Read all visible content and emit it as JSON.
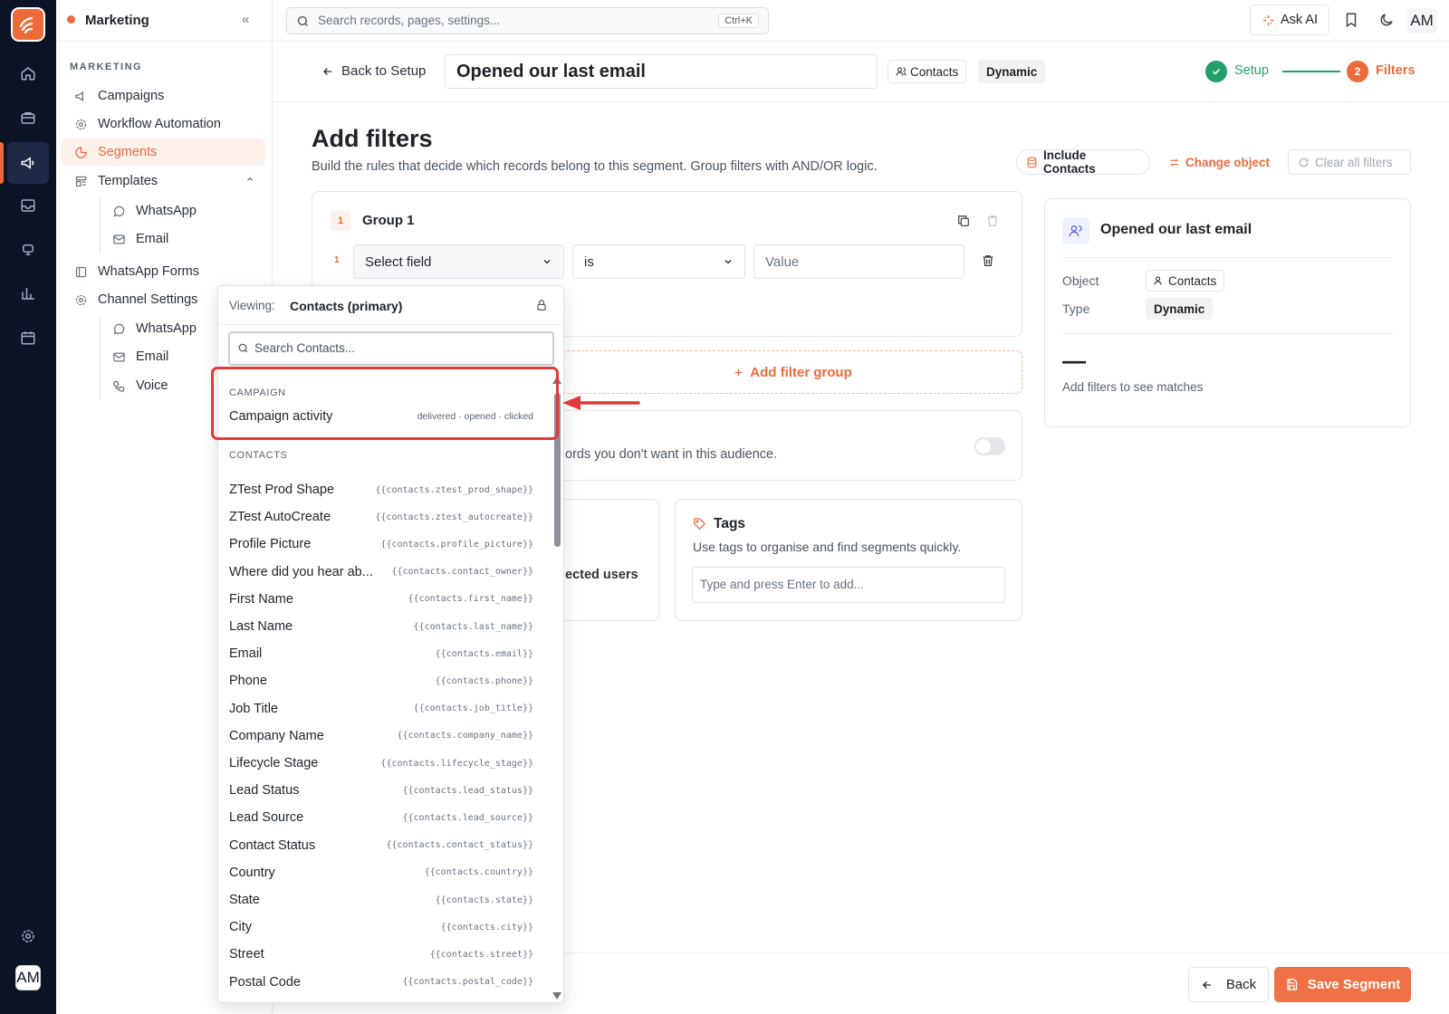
{
  "rail": {
    "avatar": "AM"
  },
  "sidebar": {
    "workspace": "Marketing",
    "collapse_icon": "«",
    "section": "MARKETING",
    "items": {
      "campaigns": "Campaigns",
      "workflow": "Workflow Automation",
      "segments": "Segments",
      "templates": "Templates",
      "tpl_whatsapp": "WhatsApp",
      "tpl_email": "Email",
      "whatsapp_forms": "WhatsApp Forms",
      "channel_settings": "Channel Settings",
      "ch_whatsapp": "WhatsApp",
      "ch_email": "Email",
      "ch_voice": "Voice"
    }
  },
  "topbar": {
    "search_placeholder": "Search records, pages, settings...",
    "shortcut": "Ctrl+K",
    "ask_ai": "Ask AI",
    "avatar": "AM"
  },
  "header": {
    "back": "Back to Setup",
    "segment_name": "Opened our last email",
    "object_chip": "Contacts",
    "type_chip": "Dynamic",
    "step1": "Setup",
    "step2_num": "2",
    "step2": "Filters"
  },
  "main": {
    "title": "Add filters",
    "subtitle": "Build the rules that decide which records belong to this segment. Group filters with AND/OR logic.",
    "include_contacts": "Include Contacts",
    "change_object": "Change object",
    "clear_all": "Clear all filters",
    "group_num": "1",
    "group_title": "Group 1",
    "row_num": "1",
    "field_placeholder": "Select field",
    "operator": "is",
    "value_placeholder": "Value",
    "add_group": "Add filter group",
    "exclude_text": "ords you don't want in this audience.",
    "selected_users_text": "ected users",
    "tags_title": "Tags",
    "tags_desc": "Use tags to organise and find segments quickly.",
    "tags_placeholder": "Type and press Enter to add..."
  },
  "summary": {
    "title": "Opened our last email",
    "object_label": "Object",
    "object_value": "Contacts",
    "type_label": "Type",
    "type_value": "Dynamic",
    "count": "—",
    "hint": "Add filters to see matches"
  },
  "footer": {
    "back": "Back",
    "save": "Save Segment"
  },
  "dropdown": {
    "viewing_label": "Viewing:",
    "viewing_value": "Contacts (primary)",
    "search_placeholder": "Search Contacts...",
    "campaign_section": "CAMPAIGN",
    "campaign_item": {
      "label": "Campaign activity",
      "meta": "delivered · opened · clicked"
    },
    "contacts_section": "CONTACTS",
    "fields": [
      {
        "label": "ZTest Prod Shape",
        "token": "{{contacts.ztest_prod_shape}}"
      },
      {
        "label": "ZTest AutoCreate",
        "token": "{{contacts.ztest_autocreate}}"
      },
      {
        "label": "Profile Picture",
        "token": "{{contacts.profile_picture}}"
      },
      {
        "label": "Where did you hear ab...",
        "token": "{{contacts.contact_owner}}"
      },
      {
        "label": "First Name",
        "token": "{{contacts.first_name}}"
      },
      {
        "label": "Last Name",
        "token": "{{contacts.last_name}}"
      },
      {
        "label": "Email",
        "token": "{{contacts.email}}"
      },
      {
        "label": "Phone",
        "token": "{{contacts.phone}}"
      },
      {
        "label": "Job Title",
        "token": "{{contacts.job_title}}"
      },
      {
        "label": "Company Name",
        "token": "{{contacts.company_name}}"
      },
      {
        "label": "Lifecycle Stage",
        "token": "{{contacts.lifecycle_stage}}"
      },
      {
        "label": "Lead Status",
        "token": "{{contacts.lead_status}}"
      },
      {
        "label": "Lead Source",
        "token": "{{contacts.lead_source}}"
      },
      {
        "label": "Contact Status",
        "token": "{{contacts.contact_status}}"
      },
      {
        "label": "Country",
        "token": "{{contacts.country}}"
      },
      {
        "label": "State",
        "token": "{{contacts.state}}"
      },
      {
        "label": "City",
        "token": "{{contacts.city}}"
      },
      {
        "label": "Street",
        "token": "{{contacts.street}}"
      },
      {
        "label": "Postal Code",
        "token": "{{contacts.postal_code}}"
      }
    ]
  },
  "colors": {
    "accent": "#ef6a3a",
    "success": "#22a06b",
    "rail": "#0d1426",
    "highlight": "#e03a3a"
  }
}
